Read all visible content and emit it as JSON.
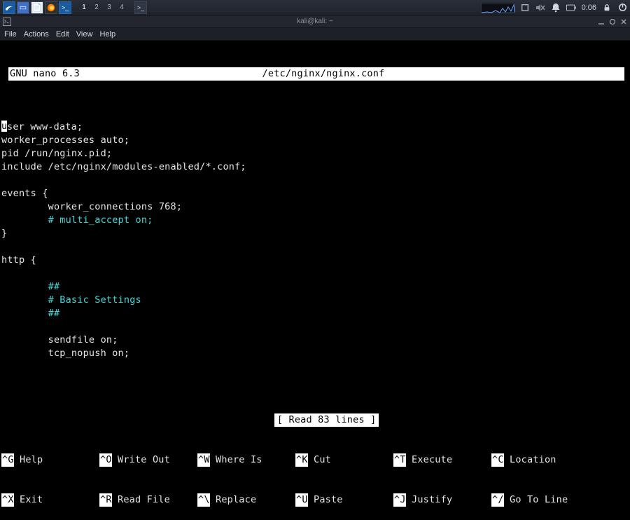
{
  "panel": {
    "workspaces": [
      "1",
      "2",
      "3",
      "4"
    ],
    "active_workspace": "1",
    "clock": "0:06"
  },
  "window": {
    "title": "kali@kali: ~"
  },
  "menubar": {
    "items": [
      "File",
      "Actions",
      "Edit",
      "View",
      "Help"
    ]
  },
  "nano": {
    "app": "GNU nano 6.3",
    "filename": "/etc/nginx/nginx.conf",
    "status": "[ Read 83 lines ]",
    "content": [
      {
        "t": "user www-data;",
        "c": "w",
        "cursor_first": true
      },
      {
        "t": "worker_processes auto;",
        "c": "w"
      },
      {
        "t": "pid /run/nginx.pid;",
        "c": "w"
      },
      {
        "t": "include /etc/nginx/modules-enabled/*.conf;",
        "c": "w"
      },
      {
        "t": "",
        "c": "w"
      },
      {
        "t": "events {",
        "c": "w"
      },
      {
        "t": "        worker_connections 768;",
        "c": "w"
      },
      {
        "t": "        # multi_accept on;",
        "c": "c"
      },
      {
        "t": "}",
        "c": "w"
      },
      {
        "t": "",
        "c": "w"
      },
      {
        "t": "http {",
        "c": "w"
      },
      {
        "t": "",
        "c": "w"
      },
      {
        "t": "        ##",
        "c": "c"
      },
      {
        "t": "        # Basic Settings",
        "c": "c"
      },
      {
        "t": "        ##",
        "c": "c"
      },
      {
        "t": "",
        "c": "w"
      },
      {
        "t": "        sendfile on;",
        "c": "w"
      },
      {
        "t": "        tcp_nopush on;",
        "c": "w"
      }
    ],
    "shortcuts_row1": [
      {
        "key": "^G",
        "label": "Help"
      },
      {
        "key": "^O",
        "label": "Write Out"
      },
      {
        "key": "^W",
        "label": "Where Is"
      },
      {
        "key": "^K",
        "label": "Cut"
      },
      {
        "key": "^T",
        "label": "Execute"
      },
      {
        "key": "^C",
        "label": "Location"
      }
    ],
    "shortcuts_row2": [
      {
        "key": "^X",
        "label": "Exit"
      },
      {
        "key": "^R",
        "label": "Read File"
      },
      {
        "key": "^\\",
        "label": "Replace"
      },
      {
        "key": "^U",
        "label": "Paste"
      },
      {
        "key": "^J",
        "label": "Justify"
      },
      {
        "key": "^/",
        "label": "Go To Line"
      }
    ]
  }
}
